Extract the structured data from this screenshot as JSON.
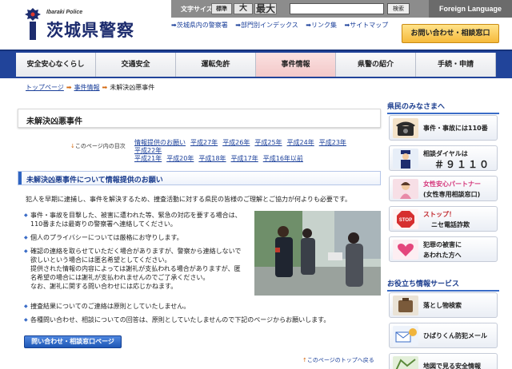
{
  "header": {
    "logo_sub": "Ibaraki Police",
    "logo_title": "茨城県警察",
    "font_size_label": "文字サイズ",
    "font_sizes": [
      "標準",
      "大",
      "最大"
    ],
    "search_button": "検索",
    "search_placeholder": "",
    "foreign_language": "Foreign Language",
    "sublinks": [
      "茨城県内の警察署",
      "部門別インデックス",
      "リンク集",
      "サイトマップ"
    ],
    "contact_button": "お問い合わせ・相談窓口"
  },
  "nav": {
    "items": [
      "安全安心なくらし",
      "交通安全",
      "運転免許",
      "事件情報",
      "県警の紹介",
      "手続・申請"
    ],
    "active_index": 3
  },
  "breadcrumb": [
    "トップページ",
    "事件情報",
    "未解決凶悪事件"
  ],
  "main": {
    "title": "未解決凶悪事件",
    "year_index_label": "このページ内の目次",
    "year_links": [
      "情報提供のお願い",
      "平成27年",
      "平成26年",
      "平成25年",
      "平成24年",
      "平成23年",
      "平成22年",
      "平成21年",
      "平成20年",
      "平成18年",
      "平成17年",
      "平成16年以前"
    ],
    "section_title": "未解決凶悪事件について情報提供のお願い",
    "intro": "犯人を早期に逮捕し、事件を解決するため、捜査活動に対する県民の皆様のご理解とご協力が何よりも必要です。",
    "bullets": [
      [
        "事件・事故を目撃した、被害に遭われた等、緊急の対応を要する場合は、",
        "110番または最寄りの警察署へ連絡してください。"
      ],
      [
        "個人のプライバシーについては厳格にお守りします。"
      ],
      [
        "確認の連絡を取らせていただく場合がありますが、警察から連絡しないで",
        "欲しいという場合には匿名希望としてください。",
        "提供された情報の内容によっては謝礼が支払われる場合がありますが、匿",
        "名希望の場合には謝礼が支払われませんのでご了承ください。",
        "なお、謝礼に関する問い合わせには応じかねます。"
      ]
    ],
    "bottom_bullets": [
      "捜査結果についてのご連絡は原則としていたしません。",
      "各種問い合わせ、相談についての回答は、原則としていたしませんので下記のページからお願いします。"
    ],
    "inquiry_button": "問い合わせ・相談窓口ページ",
    "to_top": "このページのトップへ戻る"
  },
  "sidebar": {
    "residents_head": "県民のみなさまへ",
    "residents": [
      {
        "lines": [
          "事件・事故には110番"
        ],
        "icon": "telephone-icon"
      },
      {
        "lines": [
          "相談ダイヤルは",
          "＃９１１０"
        ],
        "icon": "police-officer-icon"
      },
      {
        "lines": [
          "女性安心パートナー",
          "(女性専用相談窓口)"
        ],
        "icon": "woman-partner-icon"
      },
      {
        "lines": [
          "ストップ！",
          "ニセ電話詐欺"
        ],
        "icon": "stop-sign-icon"
      },
      {
        "lines": [
          "犯罪の被害に",
          "あわれた方へ"
        ],
        "icon": "heart-hands-icon"
      }
    ],
    "useful_head": "お役立ち情報サービス",
    "useful": [
      {
        "lines": [
          "落とし物検索"
        ],
        "icon": "lost-item-icon"
      },
      {
        "lines": [
          "ひばりくん防犯メール"
        ],
        "icon": "mail-bird-icon"
      },
      {
        "lines": [
          "地図で見る安全情報"
        ],
        "icon": "map-icon"
      }
    ]
  },
  "colors": {
    "nav_bar": "#21449a",
    "accent_blue": "#1b3d8e",
    "contact_button": "#f6b93b",
    "active_tab": "#f3c9c9"
  }
}
